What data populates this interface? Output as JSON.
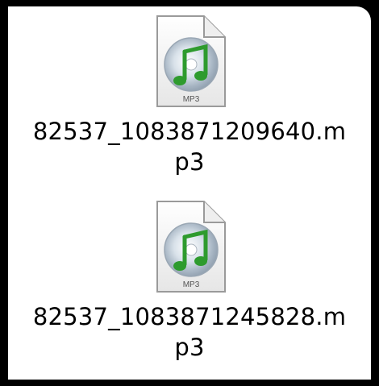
{
  "desktop": {
    "files": [
      {
        "icon": "mp3-document-icon",
        "badge": "MP3",
        "name_line1": "82537_1083871209640.m",
        "name_line2": "p3"
      },
      {
        "icon": "mp3-document-icon",
        "badge": "MP3",
        "name_line1": "82537_1083871245828.m",
        "name_line2": "p3"
      }
    ]
  },
  "colors": {
    "background": "#000000",
    "canvas": "#ffffff",
    "note_green": "#2e9b2e",
    "disc_silver": "#c8d2dc"
  }
}
